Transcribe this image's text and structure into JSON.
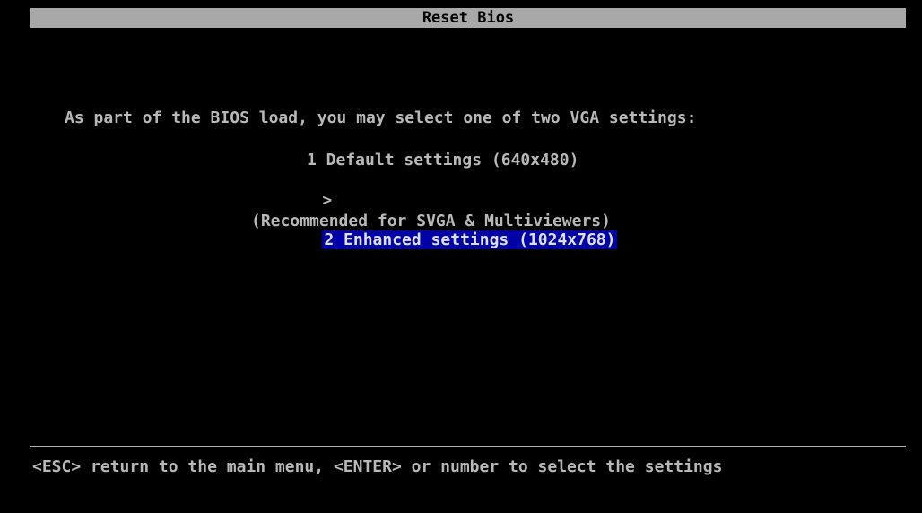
{
  "title": "Reset Bios",
  "intro": "As part of the BIOS load, you may select one of two VGA settings:",
  "options": [
    {
      "label": "1 Default settings (640x480)"
    },
    {
      "label": "2 Enhanced settings (1024x768)",
      "selected": true
    }
  ],
  "cursor": ">",
  "note": "(Recommended for SVGA & Multiviewers)",
  "footer": "<ESC> return to the main menu, <ENTER> or number to select the settings",
  "colors": {
    "background": "#000000",
    "title_bar": "#a8a8a8",
    "text": "#b8b8b8",
    "selection": "#0000a8"
  }
}
